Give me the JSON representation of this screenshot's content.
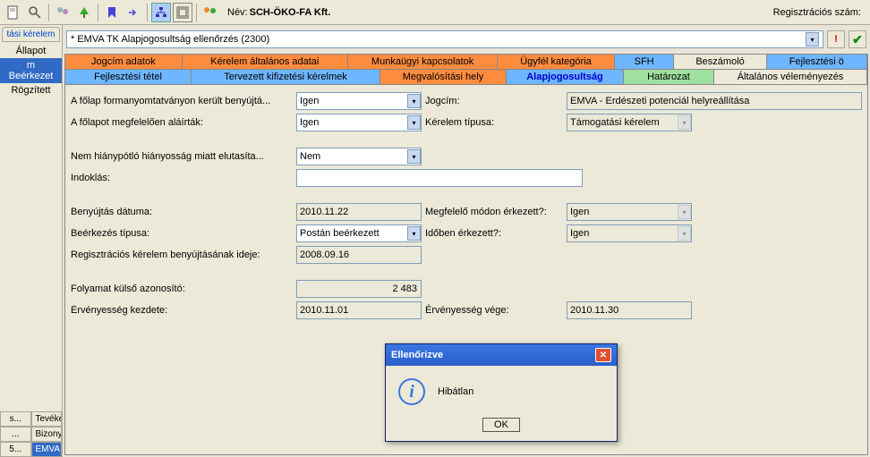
{
  "header": {
    "name_label": "Név:",
    "name_value": "SCH-ÖKO-FA Kft.",
    "reg_label": "Regisztrációs szám:"
  },
  "left": {
    "top_tab": "tási kérelem",
    "items": [
      "Állapot",
      "m Beérkezet",
      "Rögzített"
    ],
    "bottom_tabs_row1": [
      "s...",
      "Tevéke"
    ],
    "bottom_tabs_row2": [
      "...",
      "Bizonylat"
    ],
    "bottom_tabs_row3": [
      "5...",
      "EMVA TK"
    ]
  },
  "title_bar": {
    "text": "* EMVA TK Alapjogosultság ellenőrzés (2300)"
  },
  "tabs_row1": [
    "Jogcím adatok",
    "Kérelem általános adatai",
    "Munkaügyi kapcsolatok",
    "Ügyfél kategória",
    "SFH",
    "Beszámoló",
    "Fejlesztési ö"
  ],
  "tabs_row2": [
    "Fejlesztési tétel",
    "Tervezett kifizetési kérelmek",
    "Megvalósítási hely",
    "Alapjogosultság",
    "Határozat",
    "Általános véleményezés"
  ],
  "form": {
    "r1_label": "A főlap formanyomtatványon került benyújtá...",
    "r1_value": "Igen",
    "r1b_label": "Jogcím:",
    "r1b_value": "EMVA - Erdészeti potenciál helyreállítása",
    "r2_label": "A főlapot megfelelően aláírták:",
    "r2_value": "Igen",
    "r2b_label": "Kérelem típusa:",
    "r2b_value": "Támogatási kérelem",
    "r3_label": "Nem hiánypótló hiányosság miatt elutasíta...",
    "r3_value": "Nem",
    "r4_label": "Indoklás:",
    "r4_value": "",
    "r5_label": "Benyújtás dátuma:",
    "r5_value": "2010.11.22",
    "r5b_label": "Megfelelő módon érkezett?:",
    "r5b_value": "Igen",
    "r6_label": "Beérkezés típusa:",
    "r6_value": "Postán beérkezett",
    "r6b_label": "Időben érkezett?:",
    "r6b_value": "Igen",
    "r7_label": "Regisztrációs kérelem benyújtásának ideje:",
    "r7_value": "2008.09.16",
    "r8_label": "Folyamat külső azonosító:",
    "r8_value": "2 483",
    "r9_label": "Érvényesség kezdete:",
    "r9_value": "2010.11.01",
    "r9b_label": "Érvényesség vége:",
    "r9b_value": "2010.11.30"
  },
  "dialog": {
    "title": "Ellenőrizve",
    "message": "Hibátlan",
    "ok": "OK"
  }
}
